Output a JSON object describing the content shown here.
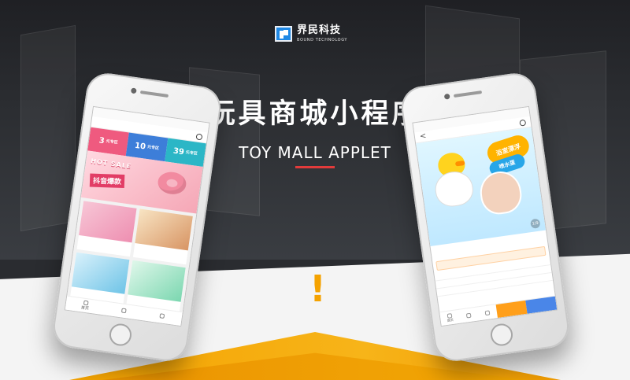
{
  "brand": {
    "cn": "界民科技",
    "en": "BOUND TECHNOLOGY"
  },
  "hero": {
    "title_cn": "玩具商城小程序",
    "title_en": "TOY MALL APPLET",
    "accent_color": "#e23b3b",
    "exclamation": "!"
  },
  "left_phone": {
    "status_left": "",
    "status_right": "",
    "nav_title": "",
    "promos": [
      {
        "big": "3",
        "small": "元专区"
      },
      {
        "big": "10",
        "small": "元专区"
      },
      {
        "big": "39",
        "small": "元专区"
      }
    ],
    "banner_tag": "HOT SALE",
    "banner_title": "抖音爆款",
    "products": [
      {
        "text": "",
        "price": ""
      },
      {
        "text": "",
        "price": ""
      },
      {
        "text": "",
        "price": ""
      },
      {
        "text": "",
        "price": ""
      }
    ],
    "tabs": [
      {
        "label": "首页"
      },
      {
        "label": ""
      },
      {
        "label": ""
      }
    ]
  },
  "right_phone": {
    "nav_title": "",
    "hero_badge_1": "浴室漂浮",
    "hero_badge_2": "喷水蛋",
    "image_counter": "1/9",
    "product_title": "",
    "price": "",
    "coupon": "",
    "specs": [
      {
        "left": "",
        "right": ""
      },
      {
        "left": "",
        "right": ""
      },
      {
        "left": "",
        "right": ""
      }
    ],
    "bottom_mini": [
      {
        "label": "首页"
      },
      {
        "label": ""
      },
      {
        "label": ""
      }
    ],
    "add_to_cart": "",
    "buy_now": ""
  }
}
